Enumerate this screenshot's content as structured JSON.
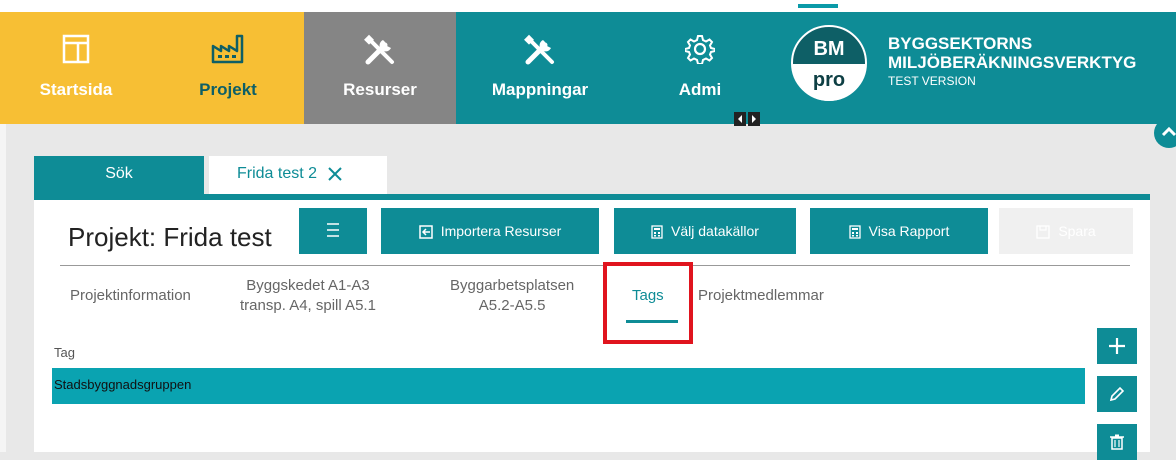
{
  "nav": {
    "items": [
      {
        "label": "Startsida",
        "icon": "layout-icon"
      },
      {
        "label": "Projekt",
        "icon": "factory-icon"
      },
      {
        "label": "Resurser",
        "icon": "tools-icon"
      },
      {
        "label": "Mappningar",
        "icon": "tools-icon"
      },
      {
        "label": "Admi",
        "icon": "gear-icon"
      }
    ],
    "colors": {
      "yellow": "#f7bf34",
      "gray": "#858585",
      "teal": "#0e8c96"
    }
  },
  "brand": {
    "logo_top": "BM",
    "logo_bottom": "pro",
    "line1": "BYGGSEKTORNS",
    "line2": "MILJÖBERÄKNINGSVERKTYG",
    "line3": "TEST VERSION"
  },
  "tabs": [
    {
      "label": "Sök"
    },
    {
      "label": "Frida test 2"
    }
  ],
  "project": {
    "title": "Projekt: Frida test",
    "buttons": {
      "import": "Importera Resurser",
      "sources": "Välj datakällor",
      "report": "Visa Rapport",
      "save": "Spara"
    }
  },
  "subtabs": {
    "info": "Projektinformation",
    "bygg_l1": "Byggskedet A1-A3",
    "bygg_l2": "transp. A4, spill A5.1",
    "arb_l1": "Byggarbetsplatsen",
    "arb_l2": "A5.2-A5.5",
    "tags": "Tags",
    "members": "Projektmedlemmar"
  },
  "table": {
    "header": "Tag",
    "rows": [
      "Stadsbyggnadsgruppen"
    ]
  }
}
